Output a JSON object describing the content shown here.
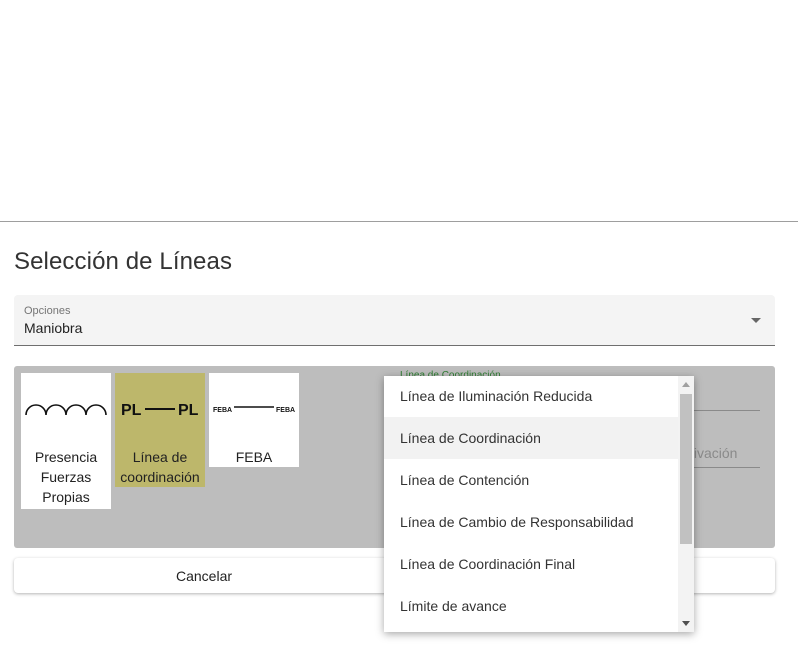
{
  "dialog": {
    "title": "Selección de Líneas"
  },
  "options_select": {
    "label": "Opciones",
    "value": "Maniobra"
  },
  "symbols": [
    {
      "name": "Presencia Fuerzas Propias",
      "selected": false
    },
    {
      "name": "Línea de coordinación",
      "selected": true,
      "icon_text": "PL"
    },
    {
      "name": "FEBA",
      "selected": false,
      "icon_text": "FEBA"
    }
  ],
  "right_fields": {
    "name_label": "Línea de Coordinación",
    "activation_placeholder": "tivación"
  },
  "buttons": {
    "cancel": "Cancelar",
    "accept": ""
  },
  "dropdown": {
    "items": [
      "Línea de Iluminación Reducida",
      "Línea de Coordinación",
      "Línea de Contención",
      "Línea de Cambio de Responsabilidad",
      "Línea de Coordinación Final",
      "Límite de avance"
    ],
    "hovered_index": 1
  },
  "colors": {
    "selected_card": "#bdb76b",
    "panel": "#bdbdbd"
  }
}
